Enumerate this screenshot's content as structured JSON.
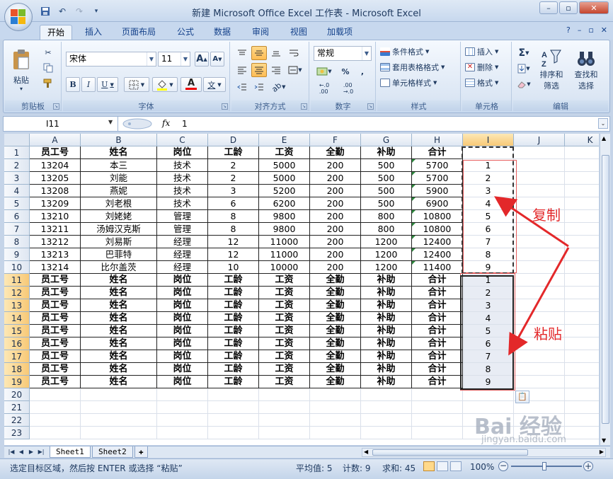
{
  "window": {
    "title": "新建 Microsoft Office Excel 工作表 - Microsoft Excel",
    "qat_icons": [
      "save-icon",
      "undo-icon",
      "redo-icon",
      "customize-icon"
    ]
  },
  "ribbon_tabs": [
    "开始",
    "插入",
    "页面布局",
    "公式",
    "数据",
    "审阅",
    "视图",
    "加载项"
  ],
  "active_tab": "开始",
  "ribbon": {
    "clipboard": {
      "label": "剪贴板",
      "paste": "粘贴"
    },
    "font": {
      "label": "字体",
      "font_name": "宋体",
      "font_size": "11",
      "bold": "B",
      "italic": "I",
      "underline": "U",
      "grow": "A",
      "shrink": "A",
      "phonetic": "文"
    },
    "alignment": {
      "label": "对齐方式"
    },
    "number": {
      "label": "数字",
      "format": "常规",
      "percent": "%",
      "comma": ","
    },
    "styles": {
      "label": "样式",
      "conditional": "条件格式",
      "table": "套用表格格式",
      "cell_styles": "单元格样式"
    },
    "cells": {
      "label": "单元格",
      "insert": "插入",
      "delete": "删除",
      "format": "格式"
    },
    "editing": {
      "label": "编辑",
      "sort": "排序和",
      "filter": "筛选",
      "find": "查找和",
      "select": "选择"
    }
  },
  "formula_bar": {
    "name_box": "I11",
    "fx": "fx",
    "value": "1"
  },
  "columns": [
    "A",
    "B",
    "C",
    "D",
    "E",
    "F",
    "G",
    "H",
    "I",
    "J",
    "K"
  ],
  "headers": [
    "员工号",
    "姓名",
    "岗位",
    "工龄",
    "工资",
    "全勤",
    "补助",
    "合计"
  ],
  "rows": [
    [
      "13204",
      "本三",
      "技术",
      "2",
      "5000",
      "200",
      "500",
      "5700"
    ],
    [
      "13205",
      "刘能",
      "技术",
      "2",
      "5000",
      "200",
      "500",
      "5700"
    ],
    [
      "13208",
      "燕妮",
      "技术",
      "3",
      "5200",
      "200",
      "500",
      "5900"
    ],
    [
      "13209",
      "刘老根",
      "技术",
      "6",
      "6200",
      "200",
      "500",
      "6900"
    ],
    [
      "13210",
      "刘姥姥",
      "管理",
      "8",
      "9800",
      "200",
      "800",
      "10800"
    ],
    [
      "13211",
      "汤姆汉克斯",
      "管理",
      "8",
      "9800",
      "200",
      "800",
      "10800"
    ],
    [
      "13212",
      "刘易斯",
      "经理",
      "12",
      "11000",
      "200",
      "1200",
      "12400"
    ],
    [
      "13213",
      "巴菲特",
      "经理",
      "12",
      "11000",
      "200",
      "1200",
      "12400"
    ],
    [
      "13214",
      "比尔盖茨",
      "经理",
      "10",
      "10000",
      "200",
      "1200",
      "11400"
    ]
  ],
  "col_i_values": [
    "1",
    "2",
    "3",
    "4",
    "5",
    "6",
    "7",
    "8",
    "9"
  ],
  "row_numbers": [
    "1",
    "2",
    "3",
    "4",
    "5",
    "6",
    "7",
    "8",
    "9",
    "10",
    "11",
    "12",
    "13",
    "14",
    "15",
    "16",
    "17",
    "18",
    "19",
    "20",
    "21",
    "22",
    "23"
  ],
  "annotations": {
    "copy": "复制",
    "paste": "粘贴"
  },
  "sheets": [
    "Sheet1",
    "Sheet2"
  ],
  "active_sheet": "Sheet1",
  "status": {
    "message": "选定目标区域，然后按 ENTER 或选择 “粘贴”",
    "average": "平均值: 5",
    "count": "计数: 9",
    "sum": "求和: 45",
    "zoom": "100%"
  },
  "watermark": {
    "main": "Bai 经验",
    "sub": "jingyan.baidu.com"
  },
  "colors": {
    "arrow_red": "#e3282a",
    "selection_fill": "#e8ecf4",
    "header_highlight": "#f8c977",
    "ribbon_blue": "#15428b"
  }
}
